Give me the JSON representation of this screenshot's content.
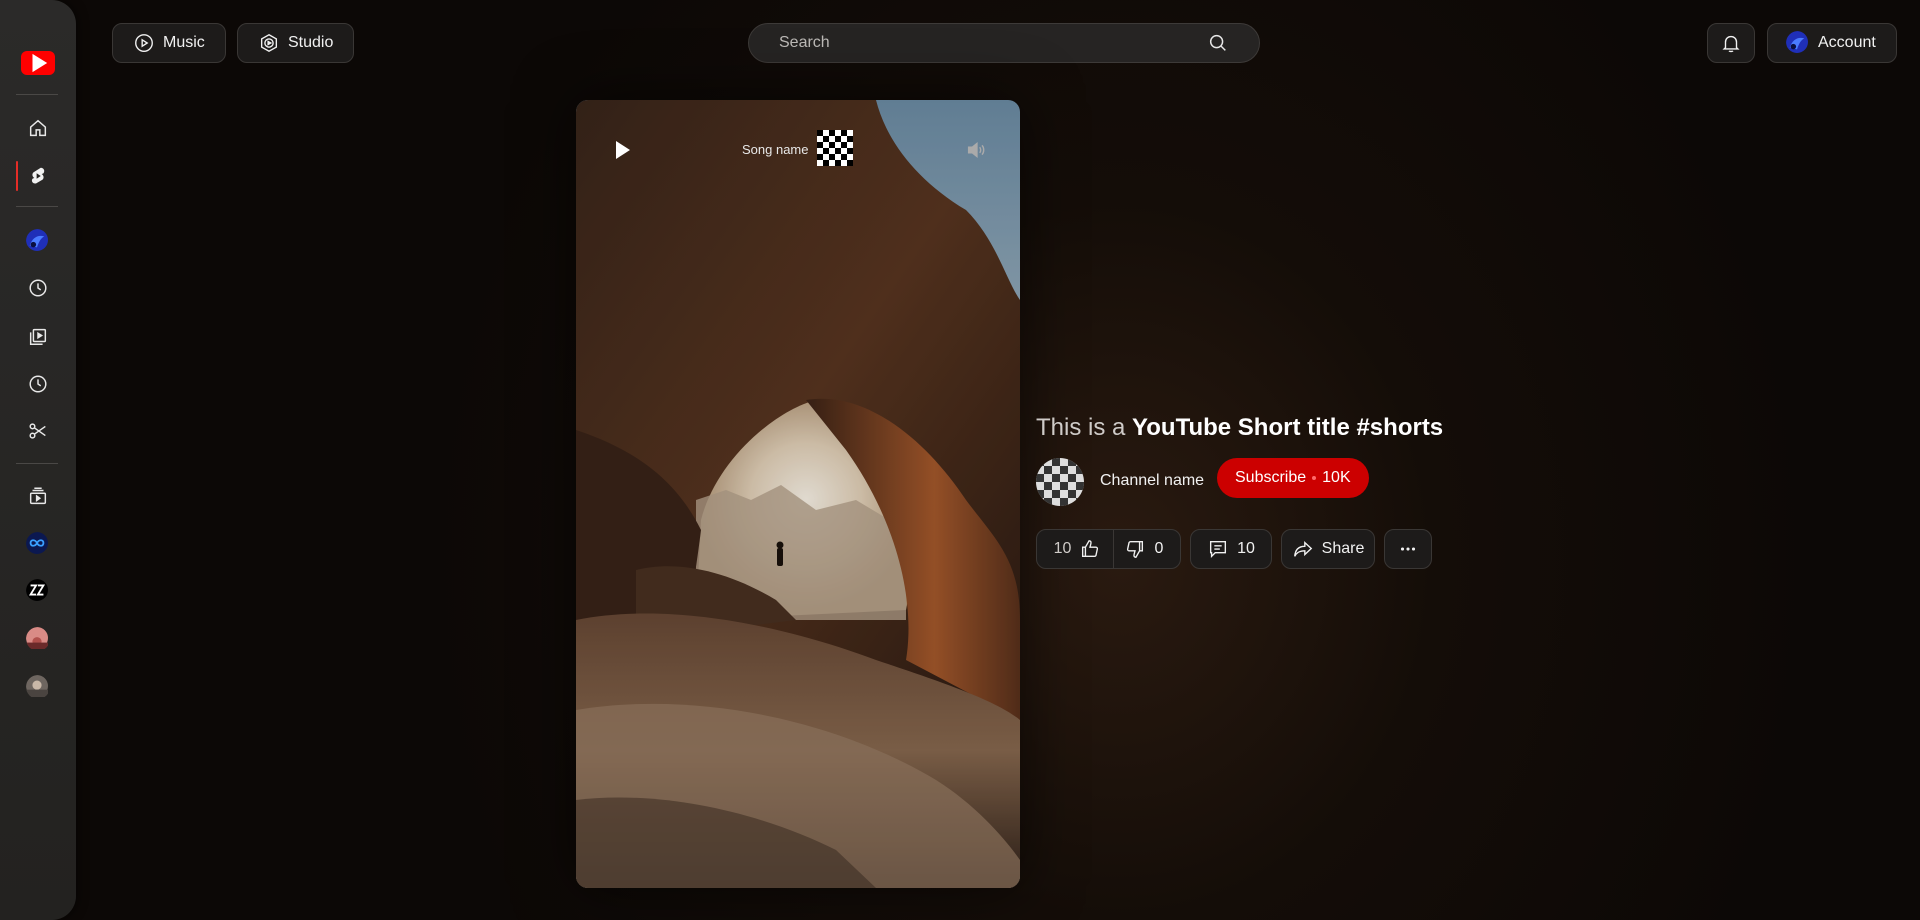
{
  "topbar": {
    "music_label": "Music",
    "studio_label": "Studio",
    "search_placeholder": "Search",
    "account_label": "Account"
  },
  "video": {
    "song_name": "Song name"
  },
  "info": {
    "title_prefix": "This is a ",
    "title_main": "YouTube Short title #shorts",
    "channel_name": "Channel name",
    "subscribe_label": "Subscribe",
    "subscriber_count": "10K"
  },
  "actions": {
    "likes": "10",
    "dislikes": "0",
    "comments": "10",
    "share_label": "Share"
  },
  "colors": {
    "accent": "#cc0000",
    "logo": "#ff0000"
  }
}
